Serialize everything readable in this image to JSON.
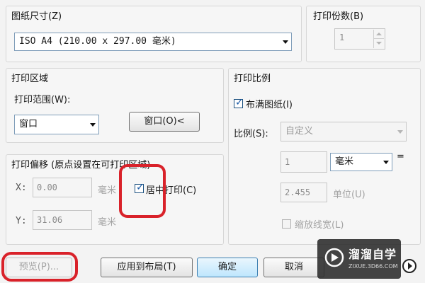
{
  "paper_size": {
    "title": "图纸尺寸(Z)",
    "selected": "ISO A4 (210.00 x 297.00 毫米)"
  },
  "copies": {
    "title": "打印份数(B)",
    "value": "1"
  },
  "print_area": {
    "title": "打印区域",
    "range_label": "打印范围(W):",
    "range_selected": "窗口",
    "window_button": "窗口(O)<"
  },
  "print_offset": {
    "title": "打印偏移 (原点设置在可打印区域)",
    "x_label": "X:",
    "x_value": "0.00",
    "x_unit": "毫米",
    "y_label": "Y:",
    "y_value": "31.06",
    "y_unit": "毫米",
    "center_label": "居中打印(C)",
    "center_checked": true
  },
  "print_scale": {
    "title": "打印比例",
    "fit_label": "布满图纸(I)",
    "fit_checked": true,
    "scale_label": "比例(S):",
    "scale_selected": "自定义",
    "value1": "1",
    "unit_selected": "毫米",
    "equals": "=",
    "value2": "2.455",
    "unit_text": "单位(U)",
    "scale_lineweights": "缩放线宽(L)"
  },
  "buttons": {
    "preview": "预览(P)...",
    "apply_layout": "应用到布局(T)",
    "ok": "确定",
    "cancel": "取消"
  },
  "watermark": {
    "name": "溜溜自学",
    "url": "ZIXUE.3D66.COM"
  },
  "colors": {
    "highlight_ring": "#d9222a",
    "watermark_bg": "#2b2b2b"
  }
}
